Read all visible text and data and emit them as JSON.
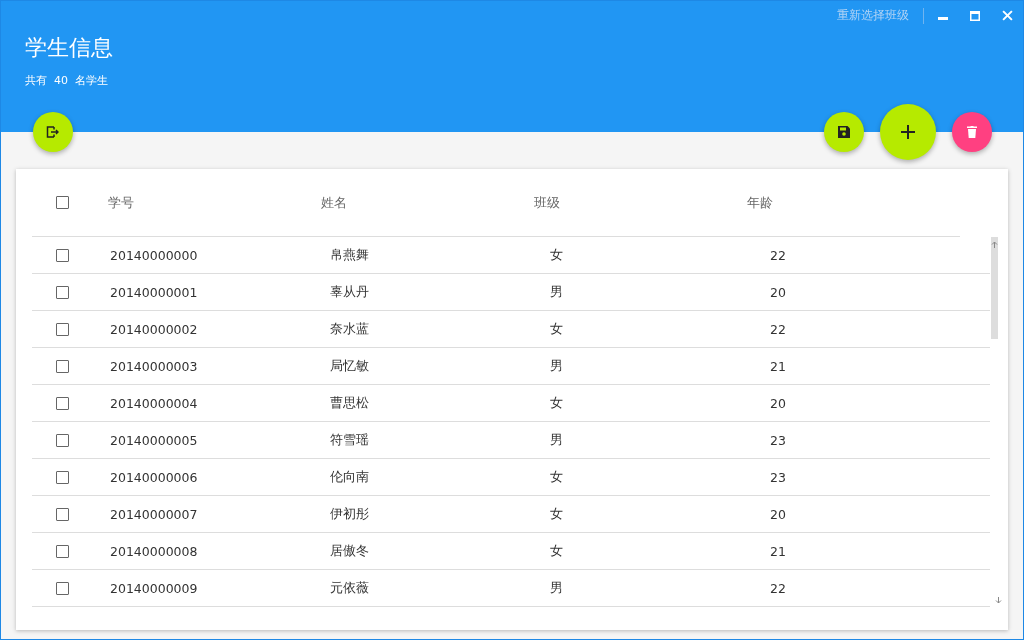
{
  "window": {
    "title": "学生信息",
    "subtitle": "共有  40  名学生",
    "reselect_link": "重新选择班级"
  },
  "table": {
    "select_all": {
      "checked": false
    },
    "columns": [
      "学号",
      "姓名",
      "班级",
      "年龄"
    ],
    "rows": [
      {
        "checked": false,
        "cells": [
          "20140000000",
          "帛燕舞",
          "女",
          "22"
        ]
      },
      {
        "checked": false,
        "cells": [
          "20140000001",
          "辜从丹",
          "男",
          "20"
        ]
      },
      {
        "checked": false,
        "cells": [
          "20140000002",
          "奈水蓝",
          "女",
          "22"
        ]
      },
      {
        "checked": false,
        "cells": [
          "20140000003",
          "局忆敏",
          "男",
          "21"
        ]
      },
      {
        "checked": false,
        "cells": [
          "20140000004",
          "曹思松",
          "女",
          "20"
        ]
      },
      {
        "checked": false,
        "cells": [
          "20140000005",
          "符雪瑶",
          "男",
          "23"
        ]
      },
      {
        "checked": false,
        "cells": [
          "20140000006",
          "伦向南",
          "女",
          "23"
        ]
      },
      {
        "checked": false,
        "cells": [
          "20140000007",
          "伊初彤",
          "女",
          "20"
        ]
      },
      {
        "checked": false,
        "cells": [
          "20140000008",
          "居傲冬",
          "女",
          "21"
        ]
      },
      {
        "checked": false,
        "cells": [
          "20140000009",
          "元依薇",
          "男",
          "22"
        ]
      }
    ]
  }
}
